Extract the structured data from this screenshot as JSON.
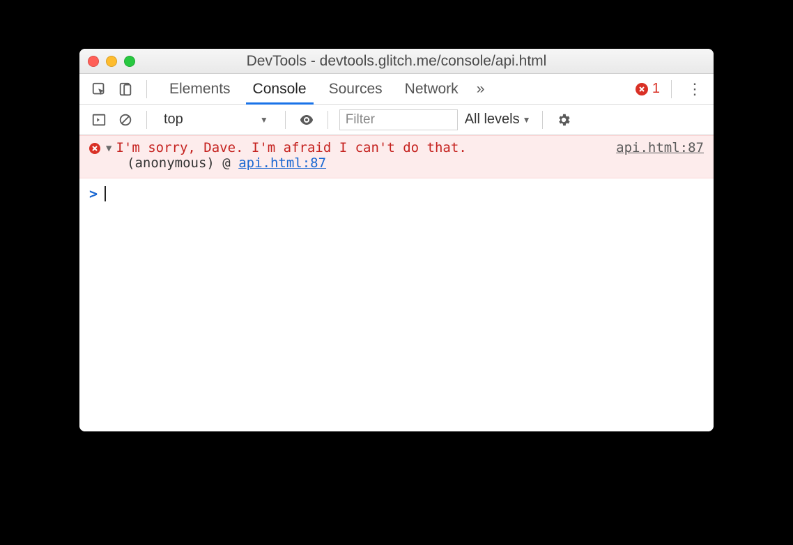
{
  "window": {
    "title": "DevTools - devtools.glitch.me/console/api.html"
  },
  "tabs": {
    "items": [
      "Elements",
      "Console",
      "Sources",
      "Network"
    ],
    "active_index": 1,
    "overflow_glyph": "»"
  },
  "error_badge": {
    "count": "1"
  },
  "filterbar": {
    "context": "top",
    "filter_placeholder": "Filter",
    "levels_label": "All levels"
  },
  "console": {
    "error": {
      "message": "I'm sorry, Dave. I'm afraid I can't do that.",
      "source_label": "api.html:87",
      "stack_prefix": "(anonymous)",
      "stack_at": "@",
      "stack_link": "api.html:87"
    },
    "prompt_glyph": ">"
  },
  "icons": {
    "inspect": "inspect-icon",
    "device": "device-icon",
    "play_frame": "execution-context-icon",
    "clear": "clear-console-icon",
    "eye": "live-expression-icon",
    "gear": "gear-icon",
    "kebab": "kebab-menu-icon",
    "chevron_down": "▼"
  }
}
